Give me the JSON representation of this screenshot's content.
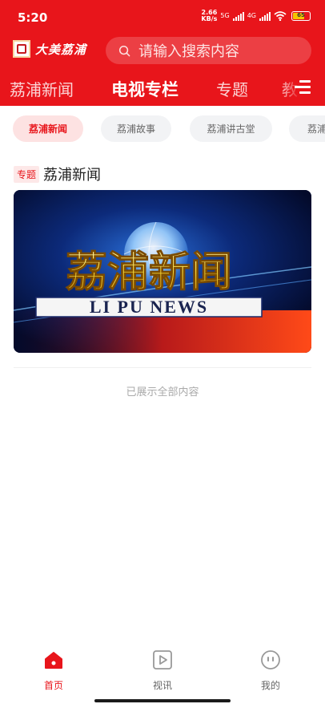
{
  "status_bar": {
    "time": "5:20",
    "net_speed_value": "2.66",
    "net_speed_unit": "KB/s",
    "network_1": "5G",
    "network_2": "4G",
    "battery": "65"
  },
  "header": {
    "logo_text": "大美荔浦",
    "search_placeholder": "请输入搜索内容"
  },
  "tabs": [
    {
      "label": "荔浦新闻",
      "active": false
    },
    {
      "label": "电视专栏",
      "active": true
    },
    {
      "label": "专题",
      "active": false
    },
    {
      "label": "教育",
      "active": false
    }
  ],
  "sub_tabs": [
    {
      "label": "荔浦新闻",
      "active": true
    },
    {
      "label": "荔浦故事",
      "active": false
    },
    {
      "label": "荔浦讲古堂",
      "active": false
    },
    {
      "label": "荔浦",
      "active": false
    }
  ],
  "section": {
    "tag": "专题",
    "title": "荔浦新闻",
    "banner_title": "荔浦新闻",
    "banner_subtitle": "LI PU NEWS"
  },
  "end_message": "已展示全部内容",
  "bottom_nav": [
    {
      "label": "首页",
      "icon": "home-icon",
      "active": true
    },
    {
      "label": "视讯",
      "icon": "video-icon",
      "active": false
    },
    {
      "label": "我的",
      "icon": "profile-icon",
      "active": false
    }
  ],
  "colors": {
    "brand": "#e8151b",
    "chip_active_bg": "#fde2e2",
    "chip_bg": "#f2f3f5"
  }
}
